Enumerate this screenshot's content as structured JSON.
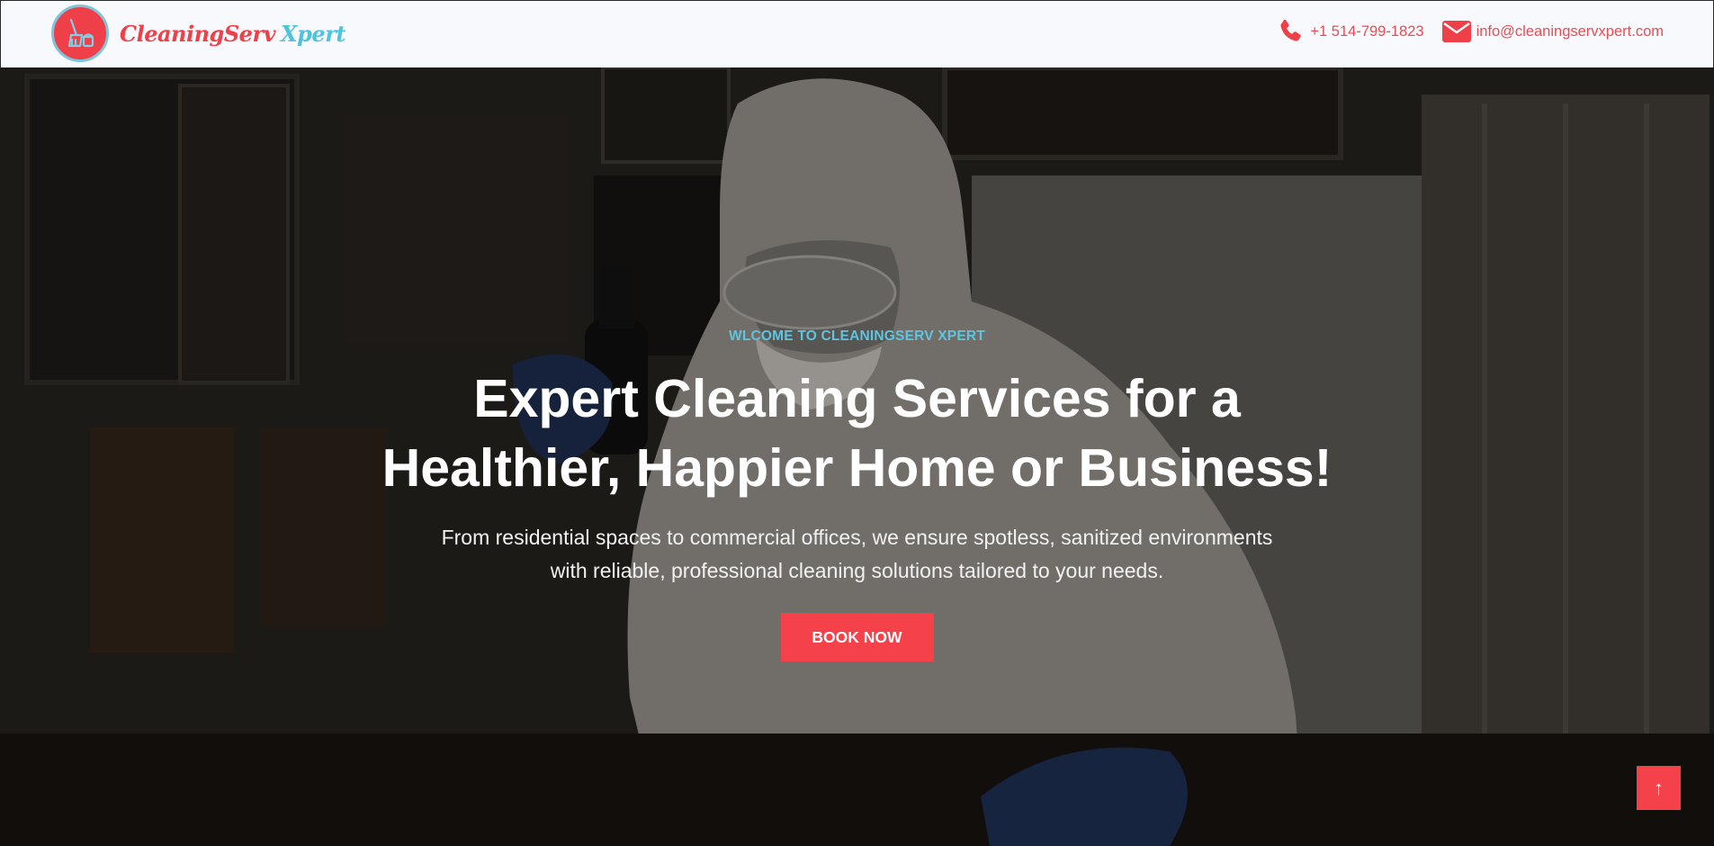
{
  "header": {
    "logo": {
      "brand_primary": "CleaningServ",
      "brand_secondary": "Xpert",
      "icon": "broom-bucket-icon"
    },
    "contact": {
      "phone": {
        "icon": "phone-icon",
        "label": "+1 514-799-1823"
      },
      "email": {
        "icon": "envelope-icon",
        "label": "info@cleaningservxpert.com"
      }
    }
  },
  "hero": {
    "background_image": "worker in protective suit, goggles and mask spraying disinfectant indoors",
    "eyebrow": "WLCOME TO CLEANINGSERV XPERT",
    "headline_line1": "Expert Cleaning Services for a",
    "headline_line2": "Healthier, Happier Home or Business!",
    "subtext_line1": "From residential spaces to commercial offices, we ensure spotless, sanitized environments",
    "subtext_line2": "with reliable, professional cleaning solutions tailored to your needs.",
    "cta_label": "BOOK NOW"
  },
  "back_to_top": {
    "icon": "arrow-up-icon",
    "glyph": "↑"
  },
  "colors": {
    "accent_red": "#f5424a",
    "accent_cyan": "#5ec4e0",
    "header_bg": "#f7f9fc",
    "text_white": "#ffffff"
  }
}
